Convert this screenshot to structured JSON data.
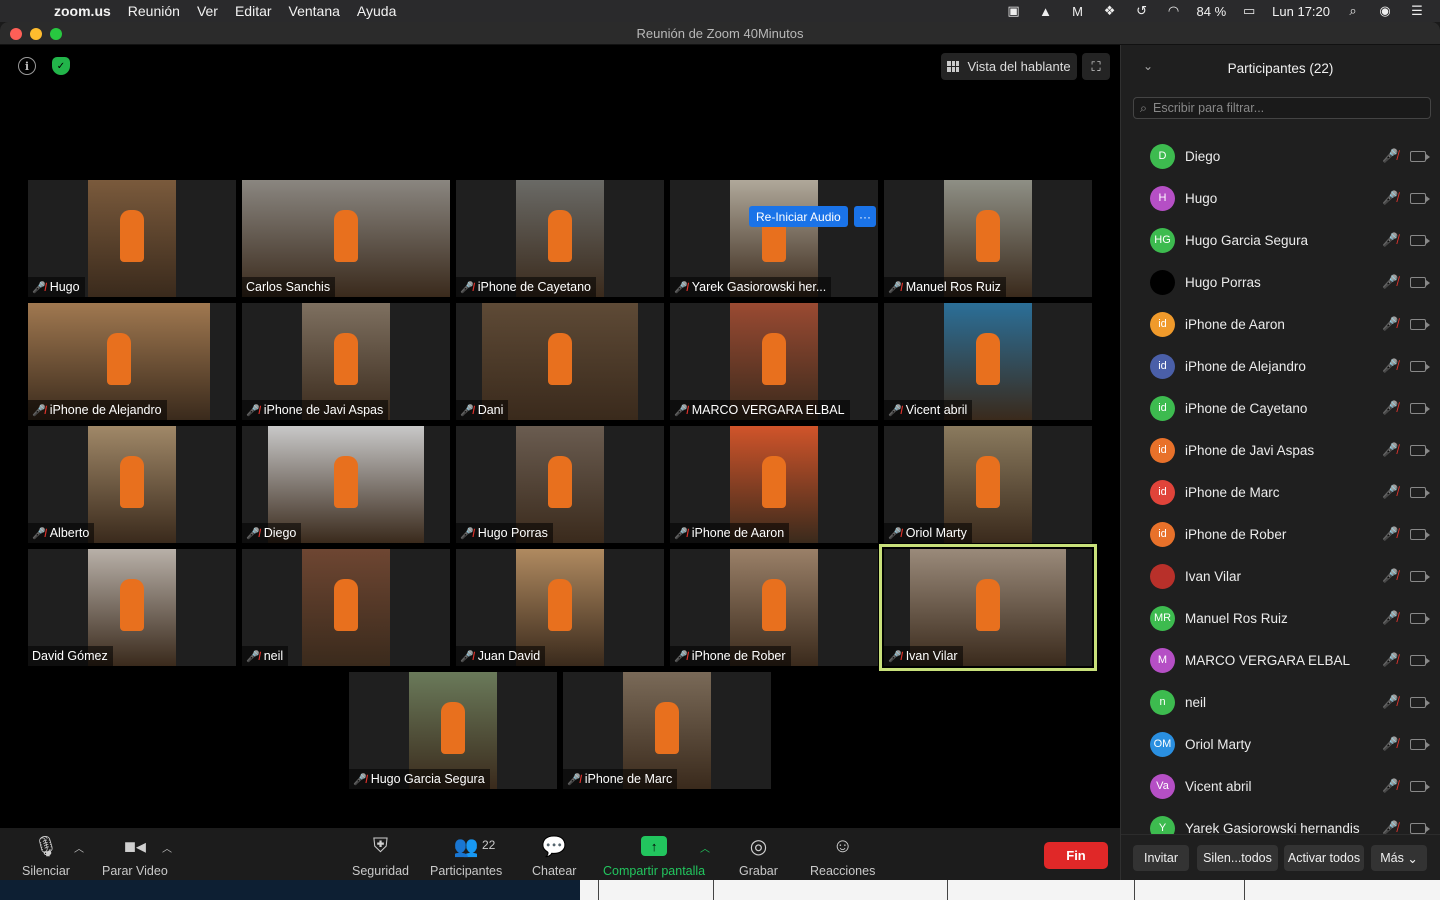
{
  "menubar": {
    "app": "zoom.us",
    "items": [
      "Reunión",
      "Ver",
      "Editar",
      "Ventana",
      "Ayuda"
    ],
    "battery": "84 %",
    "clock": "Lun 17:20"
  },
  "window": {
    "title": "Reunión de Zoom   40Minutos"
  },
  "main": {
    "speaker_view_label": "Vista del hablante",
    "reaudio_label": "Re-Iniciar Audio",
    "reaudio_more": "···"
  },
  "tiles": [
    {
      "name": "Hugo",
      "muted": true
    },
    {
      "name": "Carlos Sanchis",
      "muted": false
    },
    {
      "name": "iPhone de Cayetano",
      "muted": true
    },
    {
      "name": "Yarek Gasiorowski her...",
      "muted": true
    },
    {
      "name": "Manuel Ros Ruiz",
      "muted": true
    },
    {
      "name": "iPhone de Alejandro",
      "muted": true
    },
    {
      "name": "iPhone de Javi Aspas",
      "muted": true
    },
    {
      "name": "Dani",
      "muted": true
    },
    {
      "name": "MARCO VERGARA ELBAL",
      "muted": true
    },
    {
      "name": "Vicent abril",
      "muted": true
    },
    {
      "name": "Alberto",
      "muted": true
    },
    {
      "name": "Diego",
      "muted": true
    },
    {
      "name": "Hugo Porras",
      "muted": true
    },
    {
      "name": "iPhone de Aaron",
      "muted": true
    },
    {
      "name": "Oriol Marty",
      "muted": true
    },
    {
      "name": "David Gómez",
      "muted": false
    },
    {
      "name": "neil",
      "muted": true
    },
    {
      "name": "Juan David",
      "muted": true
    },
    {
      "name": "iPhone de Rober",
      "muted": true
    },
    {
      "name": "Ivan Vilar",
      "muted": true
    },
    {
      "name": "Hugo Garcia Segura",
      "muted": true
    },
    {
      "name": "iPhone de Marc",
      "muted": true
    }
  ],
  "toolbar": {
    "mute": "Silenciar",
    "video": "Parar Video",
    "security": "Seguridad",
    "participants": "Participantes",
    "participants_count": "22",
    "chat": "Chatear",
    "share": "Compartir pantalla",
    "record": "Grabar",
    "reactions": "Reacciones",
    "end": "Fin"
  },
  "panel": {
    "title": "Participantes (22)",
    "filter_placeholder": "Escribir para filtrar...",
    "participants": [
      {
        "initials": "D",
        "name": "Diego",
        "color": "#3dbb4f"
      },
      {
        "initials": "H",
        "name": "Hugo",
        "color": "#b54fc5"
      },
      {
        "initials": "HG",
        "name": "Hugo Garcia Segura",
        "color": "#3dbb4f"
      },
      {
        "initials": "",
        "name": "Hugo Porras",
        "color": "#000000"
      },
      {
        "initials": "id",
        "name": "iPhone de Aaron",
        "color": "#f09a2b"
      },
      {
        "initials": "id",
        "name": "iPhone de Alejandro",
        "color": "#4a5fa8"
      },
      {
        "initials": "id",
        "name": "iPhone de Cayetano",
        "color": "#3dbb4f"
      },
      {
        "initials": "id",
        "name": "iPhone de Javi Aspas",
        "color": "#e8712a"
      },
      {
        "initials": "id",
        "name": "iPhone de Marc",
        "color": "#e0443a"
      },
      {
        "initials": "id",
        "name": "iPhone de Rober",
        "color": "#e8712a"
      },
      {
        "initials": "",
        "name": "Ivan Vilar",
        "color": "#b8302a"
      },
      {
        "initials": "MR",
        "name": "Manuel Ros Ruiz",
        "color": "#3dbb4f"
      },
      {
        "initials": "M",
        "name": "MARCO VERGARA ELBAL",
        "color": "#b54fc5"
      },
      {
        "initials": "n",
        "name": "neil",
        "color": "#3dbb4f"
      },
      {
        "initials": "OM",
        "name": "Oriol Marty",
        "color": "#2a8fe0"
      },
      {
        "initials": "Va",
        "name": "Vicent abril",
        "color": "#b54fc5"
      },
      {
        "initials": "Y",
        "name": "Yarek Gasiorowski hernandis",
        "color": "#3dbb4f"
      }
    ],
    "invite": "Invitar",
    "mute_all": "Silen...todos",
    "unmute_all": "Activar todos",
    "more": "Más"
  }
}
